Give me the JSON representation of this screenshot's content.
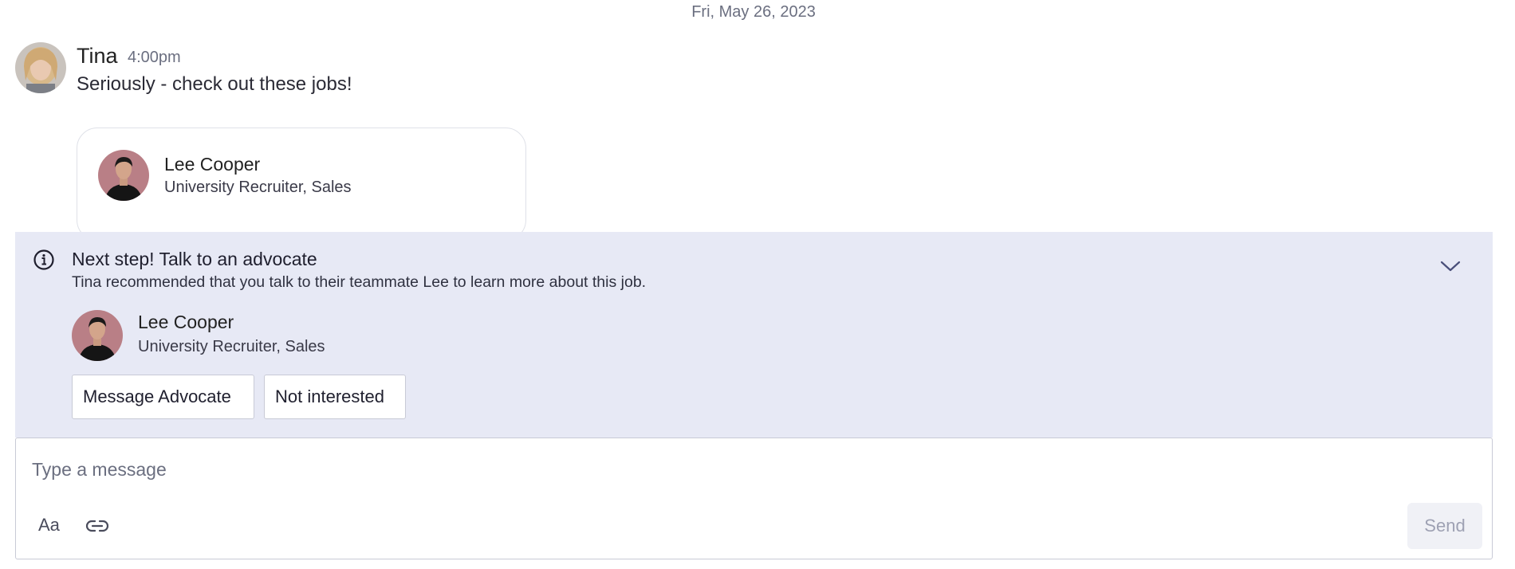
{
  "date_divider": "Fri, May 26, 2023",
  "message": {
    "author": "Tina",
    "time": "4:00pm",
    "text": "Seriously - check out these jobs!"
  },
  "job_card": {
    "name": "Lee Cooper",
    "role": "University Recruiter, Sales"
  },
  "next_step": {
    "title": "Next step! Talk to an advocate",
    "description": "Tina recommended that you talk to their teammate Lee to learn more about this job.",
    "advocate_name": "Lee Cooper",
    "advocate_role": "University Recruiter, Sales",
    "message_button": "Message Advocate",
    "not_interested_button": "Not interested"
  },
  "composer": {
    "placeholder": "Type a message",
    "format_label": "Aa",
    "send_label": "Send"
  },
  "icons": {
    "info": "info-icon",
    "collapse": "chevron-down-icon",
    "link": "link-icon"
  },
  "colors": {
    "panel_bg": "#e7e9f5",
    "send_disabled": "#9ea1b3"
  }
}
